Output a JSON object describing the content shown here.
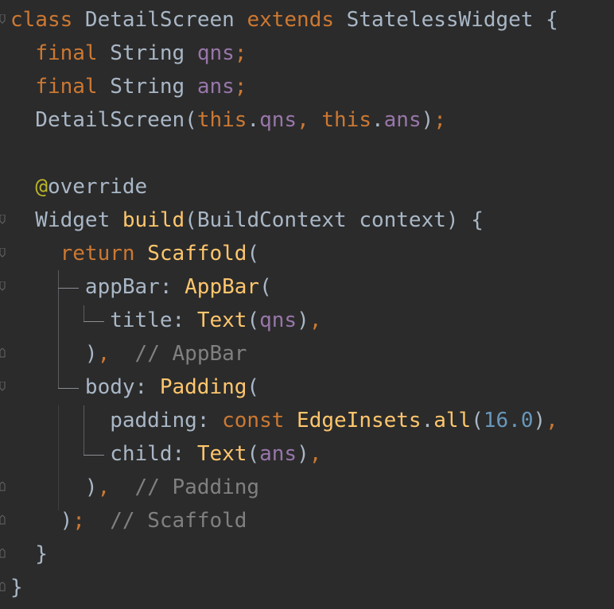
{
  "editor": {
    "lines": [
      [
        [
          "kw",
          "class"
        ],
        [
          "plain",
          " DetailScreen "
        ],
        [
          "kw",
          "extends"
        ],
        [
          "plain",
          " StatelessWidget {"
        ]
      ],
      [
        [
          "plain",
          "  "
        ],
        [
          "kw",
          "final"
        ],
        [
          "plain",
          " String "
        ],
        [
          "field",
          "qns"
        ],
        [
          "kw",
          ";"
        ]
      ],
      [
        [
          "plain",
          "  "
        ],
        [
          "kw",
          "final"
        ],
        [
          "plain",
          " String "
        ],
        [
          "field",
          "ans"
        ],
        [
          "kw",
          ";"
        ]
      ],
      [
        [
          "plain",
          "  DetailScreen("
        ],
        [
          "kw",
          "this"
        ],
        [
          "plain",
          "."
        ],
        [
          "field",
          "qns"
        ],
        [
          "kw",
          ", "
        ],
        [
          "kw",
          "this"
        ],
        [
          "plain",
          "."
        ],
        [
          "field",
          "ans"
        ],
        [
          "plain",
          ")"
        ],
        [
          "kw",
          ";"
        ]
      ],
      [
        [
          "plain",
          ""
        ]
      ],
      [
        [
          "plain",
          "  "
        ],
        [
          "anno",
          "@"
        ],
        [
          "plain",
          "override"
        ]
      ],
      [
        [
          "plain",
          "  Widget "
        ],
        [
          "fn",
          "build"
        ],
        [
          "plain",
          "(BuildContext context) {"
        ]
      ],
      [
        [
          "plain",
          "    "
        ],
        [
          "kw",
          "return"
        ],
        [
          "plain",
          " "
        ],
        [
          "fn",
          "Scaffold"
        ],
        [
          "plain",
          "("
        ]
      ],
      [
        [
          "plain",
          "      appBar: "
        ],
        [
          "fn",
          "AppBar"
        ],
        [
          "plain",
          "("
        ]
      ],
      [
        [
          "plain",
          "        title: "
        ],
        [
          "fn",
          "Text"
        ],
        [
          "plain",
          "("
        ],
        [
          "field",
          "qns"
        ],
        [
          "plain",
          ")"
        ],
        [
          "kw",
          ","
        ]
      ],
      [
        [
          "plain",
          "      )"
        ],
        [
          "kw",
          ","
        ],
        [
          "plain",
          "  "
        ],
        [
          "cmt",
          "// AppBar"
        ]
      ],
      [
        [
          "plain",
          "      body: "
        ],
        [
          "fn",
          "Padding"
        ],
        [
          "plain",
          "("
        ]
      ],
      [
        [
          "plain",
          "        padding: "
        ],
        [
          "kw",
          "const"
        ],
        [
          "plain",
          " "
        ],
        [
          "fn",
          "EdgeInsets"
        ],
        [
          "plain",
          "."
        ],
        [
          "fn",
          "all"
        ],
        [
          "plain",
          "("
        ],
        [
          "num",
          "16.0"
        ],
        [
          "plain",
          ")"
        ],
        [
          "kw",
          ","
        ]
      ],
      [
        [
          "plain",
          "        child: "
        ],
        [
          "fn",
          "Text"
        ],
        [
          "plain",
          "("
        ],
        [
          "field",
          "ans"
        ],
        [
          "plain",
          ")"
        ],
        [
          "kw",
          ","
        ]
      ],
      [
        [
          "plain",
          "      )"
        ],
        [
          "kw",
          ","
        ],
        [
          "plain",
          "  "
        ],
        [
          "cmt",
          "// Padding"
        ]
      ],
      [
        [
          "plain",
          "    )"
        ],
        [
          "kw",
          ";"
        ],
        [
          "plain",
          "  "
        ],
        [
          "cmt",
          "// Scaffold"
        ]
      ],
      [
        [
          "plain",
          "  }"
        ]
      ],
      [
        [
          "plain",
          "}"
        ]
      ]
    ]
  }
}
